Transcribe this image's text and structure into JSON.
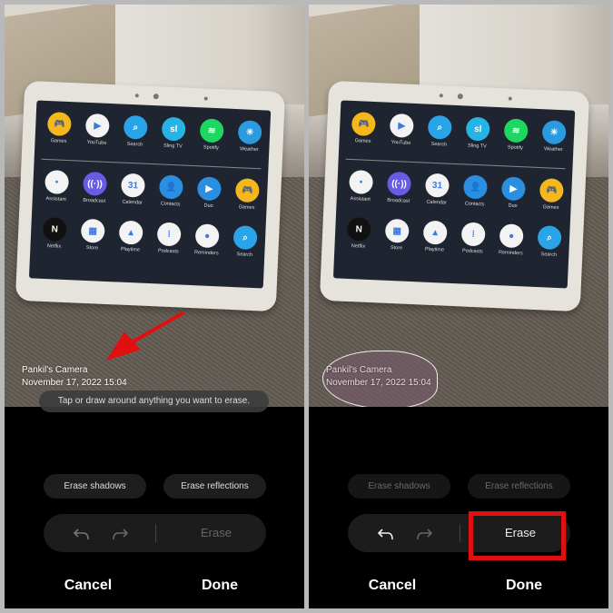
{
  "photo": {
    "watermark_name": "Pankil's Camera",
    "watermark_date": "November 17, 2022 15:04"
  },
  "apps": [
    {
      "label": "Games",
      "color": "#f4b81d",
      "glyph": "🎮"
    },
    {
      "label": "YouTube",
      "color": "#f3f3f3",
      "glyph": "▶"
    },
    {
      "label": "Search",
      "color": "#2aa4e8",
      "glyph": "⌕"
    },
    {
      "label": "Sling TV",
      "color": "#26b4e6",
      "glyph": "sl"
    },
    {
      "label": "Spotify",
      "color": "#1ed760",
      "glyph": "≋"
    },
    {
      "label": "Weather",
      "color": "#2a9be0",
      "glyph": "☀"
    },
    {
      "label": "Assistant",
      "color": "#f3f3f3",
      "glyph": "•"
    },
    {
      "label": "Broadcast",
      "color": "#6a5be6",
      "glyph": "((·))"
    },
    {
      "label": "Calendar",
      "color": "#f3f3f3",
      "glyph": "31"
    },
    {
      "label": "Contacts",
      "color": "#2a8fe0",
      "glyph": "👤"
    },
    {
      "label": "Duo",
      "color": "#2a8fe0",
      "glyph": "▶"
    },
    {
      "label": "Games",
      "color": "#f4b81d",
      "glyph": "🎮"
    },
    {
      "label": "Netflix",
      "color": "#111111",
      "glyph": "N"
    },
    {
      "label": "Store",
      "color": "#f3f3f3",
      "glyph": "▦"
    },
    {
      "label": "Playtime",
      "color": "#f3f3f3",
      "glyph": "▲"
    },
    {
      "label": "Podcasts",
      "color": "#f3f3f3",
      "glyph": "⁞"
    },
    {
      "label": "Reminders",
      "color": "#f3f3f3",
      "glyph": "●"
    },
    {
      "label": "Search",
      "color": "#2aa4e8",
      "glyph": "⌕"
    }
  ],
  "left": {
    "toast": "Tap or draw around anything you want to erase.",
    "erase_shadows": "Erase shadows",
    "erase_reflections": "Erase reflections",
    "erase": "Erase",
    "cancel": "Cancel",
    "done": "Done"
  },
  "right": {
    "erase_shadows": "Erase shadows",
    "erase_reflections": "Erase reflections",
    "erase": "Erase",
    "cancel": "Cancel",
    "done": "Done"
  },
  "colors": {
    "highlight": "#e01010",
    "arrow": "#e01010",
    "background": "#000000"
  }
}
